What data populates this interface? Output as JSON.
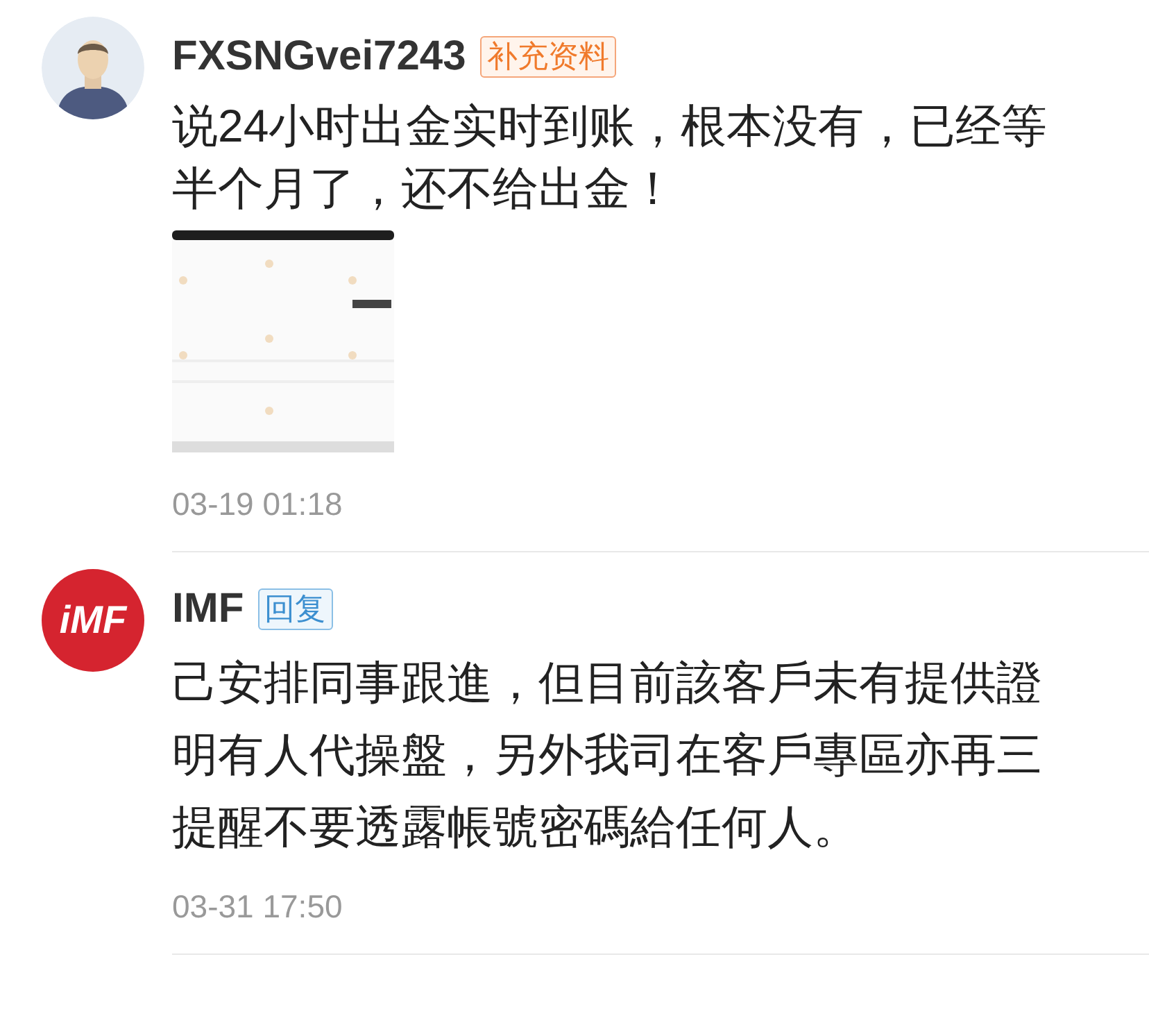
{
  "comments": [
    {
      "kind": "user",
      "name": "FXSNGvei7243",
      "tag": {
        "label": "补充资料",
        "kind": "supplement"
      },
      "text": "说24小时出金实时到账，根本没有，已经等半个月了，还不给出金！",
      "time": "03-19 01:18"
    },
    {
      "kind": "company",
      "name": "IMF",
      "logo_text": "iMF",
      "tag": {
        "label": "回复",
        "kind": "reply"
      },
      "text": "己安排同事跟進，但目前該客戶未有提供證明有人代操盤，另外我司在客戶專區亦再三提醒不要透露帳號密碼給任何人。",
      "time": "03-31 17:50"
    }
  ]
}
